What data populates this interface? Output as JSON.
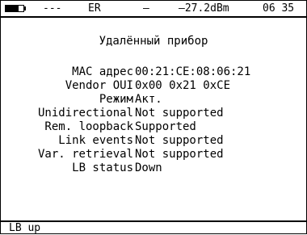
{
  "status": {
    "battery_icon": "battery-icon",
    "dashes": "---",
    "mode": "ER",
    "separator": "–",
    "level": "–27.2dBm",
    "time": "06 35"
  },
  "title": "Удалённый прибор",
  "fields": [
    {
      "key": "MAC адрес",
      "value": "00:21:CE:08:06:21"
    },
    {
      "key": "Vendor OUI",
      "value": "0x00 0x21 0xCE"
    },
    {
      "key": "Режим",
      "value": "Акт."
    },
    {
      "key": "Unidirectional",
      "value": "Not supported"
    },
    {
      "key": "Rem. loopback",
      "value": "Supported"
    },
    {
      "key": "Link events",
      "value": "Not supported"
    },
    {
      "key": "Var. retrieval",
      "value": "Not supported"
    },
    {
      "key": "LB status",
      "value": "Down"
    }
  ],
  "softkeys": {
    "f1": "LB up"
  }
}
